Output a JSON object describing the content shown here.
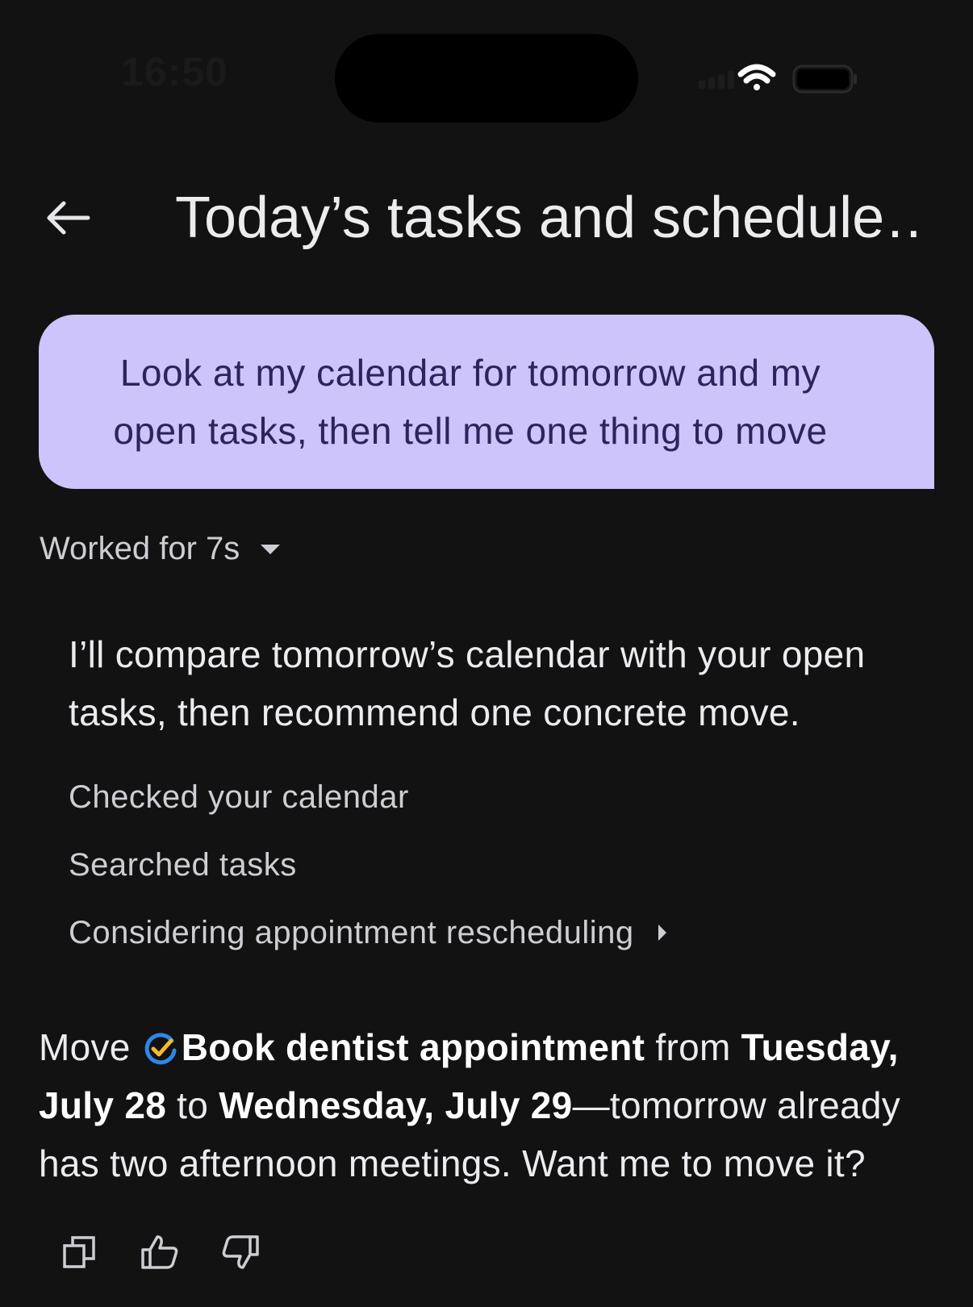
{
  "status_bar": {
    "time": "16:50",
    "icons": [
      "signal-icon",
      "wifi-icon",
      "battery-icon"
    ]
  },
  "header": {
    "back_icon": "arrow-left-icon",
    "title": "Today’s tasks and schedule…"
  },
  "user_message": {
    "text": "Look at my calendar for tomorrow and my open tasks, then tell me one thing to move"
  },
  "assistant": {
    "worked_label": "Worked for 7s",
    "thinking_text": "I’ll compare tomorrow’s calendar with your open tasks, then recommend one concrete move.",
    "steps": [
      {
        "label": "Checked your calendar"
      },
      {
        "label": "Searched tasks"
      },
      {
        "label": "Considering appointment rescheduling"
      }
    ],
    "answer": {
      "prefix": "Move ",
      "task_name": "Book dentist appointment",
      "from_word": " from ",
      "from_date": "Tuesday, July 28",
      "to_word": " to ",
      "to_date": "Wednesday, July 29",
      "suffix": "—tomorrow already has two afternoon meetings. Want me to move it?"
    },
    "actions": [
      {
        "icon": "copy-icon"
      },
      {
        "icon": "thumbs-up-icon"
      },
      {
        "icon": "thumbs-down-icon"
      }
    ]
  },
  "colors": {
    "background": "#121212",
    "user_bubble": "#cdc4fb",
    "user_text": "#2e235f",
    "task_icon_blue": "#2f86e8",
    "task_icon_yellow": "#f5b82e"
  }
}
